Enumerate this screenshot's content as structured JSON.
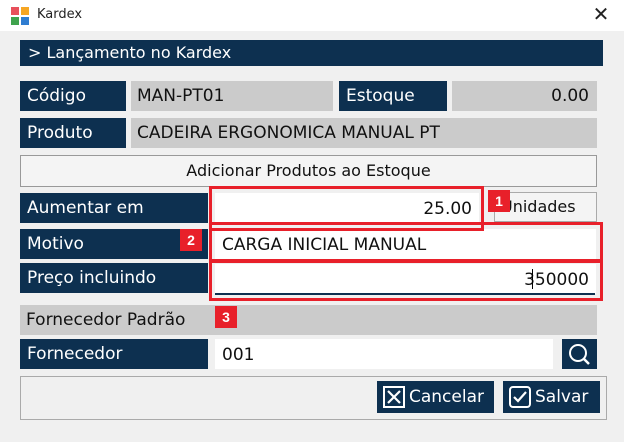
{
  "window": {
    "title": "Kardex"
  },
  "header": {
    "title": "> Lançamento no Kardex"
  },
  "fields": {
    "codigo_label": "Código",
    "codigo_value": "MAN-PT01",
    "estoque_label": "Estoque",
    "estoque_value": "0.00",
    "produto_label": "Produto",
    "produto_value": "CADEIRA ERGONOMICA MANUAL PT",
    "add_button": "Adicionar Produtos ao Estoque",
    "aumentar_label": "Aumentar em",
    "aumentar_value": "25.00",
    "unidades_label": "Unidades",
    "motivo_label": "Motivo",
    "motivo_value": "CARGA INICIAL MANUAL",
    "preco_label": "Preço incluindo",
    "preco_value": "350000",
    "fornecedor_padrao_label": "Fornecedor Padrão",
    "fornecedor_label": "Fornecedor",
    "fornecedor_value": "001"
  },
  "badges": [
    "1",
    "2",
    "3"
  ],
  "actions": {
    "cancel_label": "Cancelar",
    "save_label": "Salvar"
  },
  "colors": {
    "navy": "#0d3050",
    "highlight_red": "#e8202a",
    "gray_field": "#cbcbcb"
  },
  "icons": {
    "app": "kardex-app-icon",
    "close": "close-icon",
    "search": "search-icon",
    "cancel": "cancel-x-icon",
    "save": "checkmark-icon"
  }
}
